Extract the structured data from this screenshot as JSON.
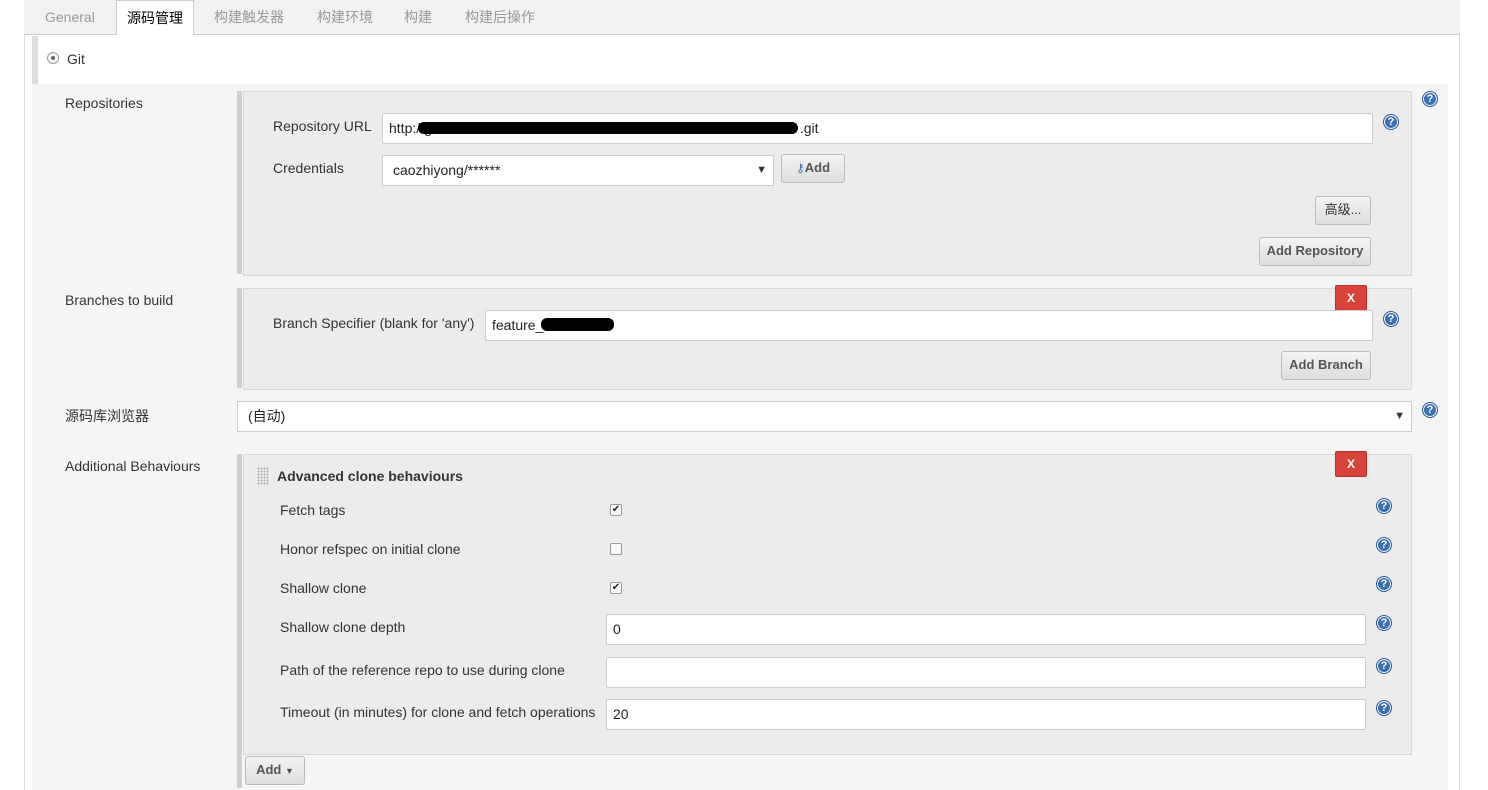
{
  "tabs": [
    {
      "label": "General"
    },
    {
      "label": "源码管理"
    },
    {
      "label": "构建触发器"
    },
    {
      "label": "构建环境"
    },
    {
      "label": "构建"
    },
    {
      "label": "构建后操作"
    }
  ],
  "scm": {
    "git_label": "Git"
  },
  "repositories": {
    "section_label": "Repositories",
    "url_label": "Repository URL",
    "url_prefix": "http://g",
    "url_suffix": ".git",
    "credentials_label": "Credentials",
    "credentials_value": "caozhiyong/******",
    "add_label": "Add",
    "advanced_label": "高级...",
    "add_repository_label": "Add Repository"
  },
  "branches": {
    "section_label": "Branches to build",
    "remove_label": "X",
    "specifier_label": "Branch Specifier (blank for 'any')",
    "specifier_value": "feature_",
    "add_branch_label": "Add Branch"
  },
  "browser": {
    "label": "源码库浏览器",
    "value": "(自动)"
  },
  "behaviours": {
    "section_label": "Additional Behaviours",
    "remove_label": "X",
    "title": "Advanced clone behaviours",
    "fetch_tags": {
      "label": "Fetch tags",
      "checked": true
    },
    "honor_refspec": {
      "label": "Honor refspec on initial clone",
      "checked": false
    },
    "shallow_clone": {
      "label": "Shallow clone",
      "checked": true
    },
    "depth": {
      "label": "Shallow clone depth",
      "value": "0"
    },
    "reference": {
      "label": "Path of the reference repo to use during clone",
      "value": ""
    },
    "timeout": {
      "label": "Timeout (in minutes) for clone and fetch operations",
      "value": "20"
    },
    "add_label": "Add"
  },
  "icons": {
    "help": "help-icon",
    "checkmark": "checkmark-icon",
    "key": "key-icon",
    "drag": "drag-handle-icon"
  },
  "colors": {
    "remove_button": "#d9443a",
    "help_icon": "#3a6fb3"
  }
}
